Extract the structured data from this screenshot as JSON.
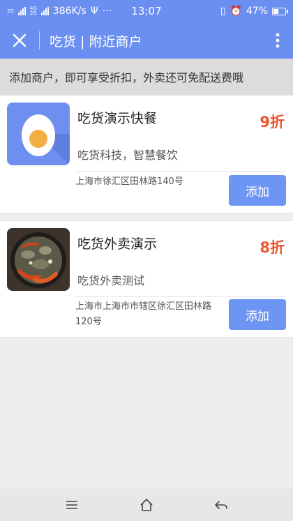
{
  "status_bar": {
    "network_labels": [
      "2G",
      "4G",
      "2G"
    ],
    "speed": "386K/s",
    "time": "13:07",
    "battery": "47%",
    "battery_level": 0.47
  },
  "header": {
    "title": "吃货 | 附近商户",
    "close_icon": "close-icon",
    "more_icon": "more-vertical-icon",
    "background_color": "#6a8ff0"
  },
  "notice": {
    "text": "添加商户，即可享受折扣，外卖还可免配送费哦"
  },
  "merchants": [
    {
      "name": "吃货演示快餐",
      "discount": "9折",
      "description": "吃货科技，智慧餐饮",
      "address": "上海市徐汇区田林路140号",
      "button": "添加",
      "image": "egg-logo"
    },
    {
      "name": "吃货外卖演示",
      "discount": "8折",
      "description": "吃货外卖测试",
      "address": "上海市上海市市辖区徐汇区田林路120号",
      "button": "添加",
      "image": "crayfish-photo"
    }
  ],
  "nav": {
    "items": [
      "menu-icon",
      "home-icon",
      "back-icon"
    ]
  },
  "colors": {
    "accent": "#6a8ff0",
    "button": "#6d95f3",
    "discount": "#e9562f"
  }
}
